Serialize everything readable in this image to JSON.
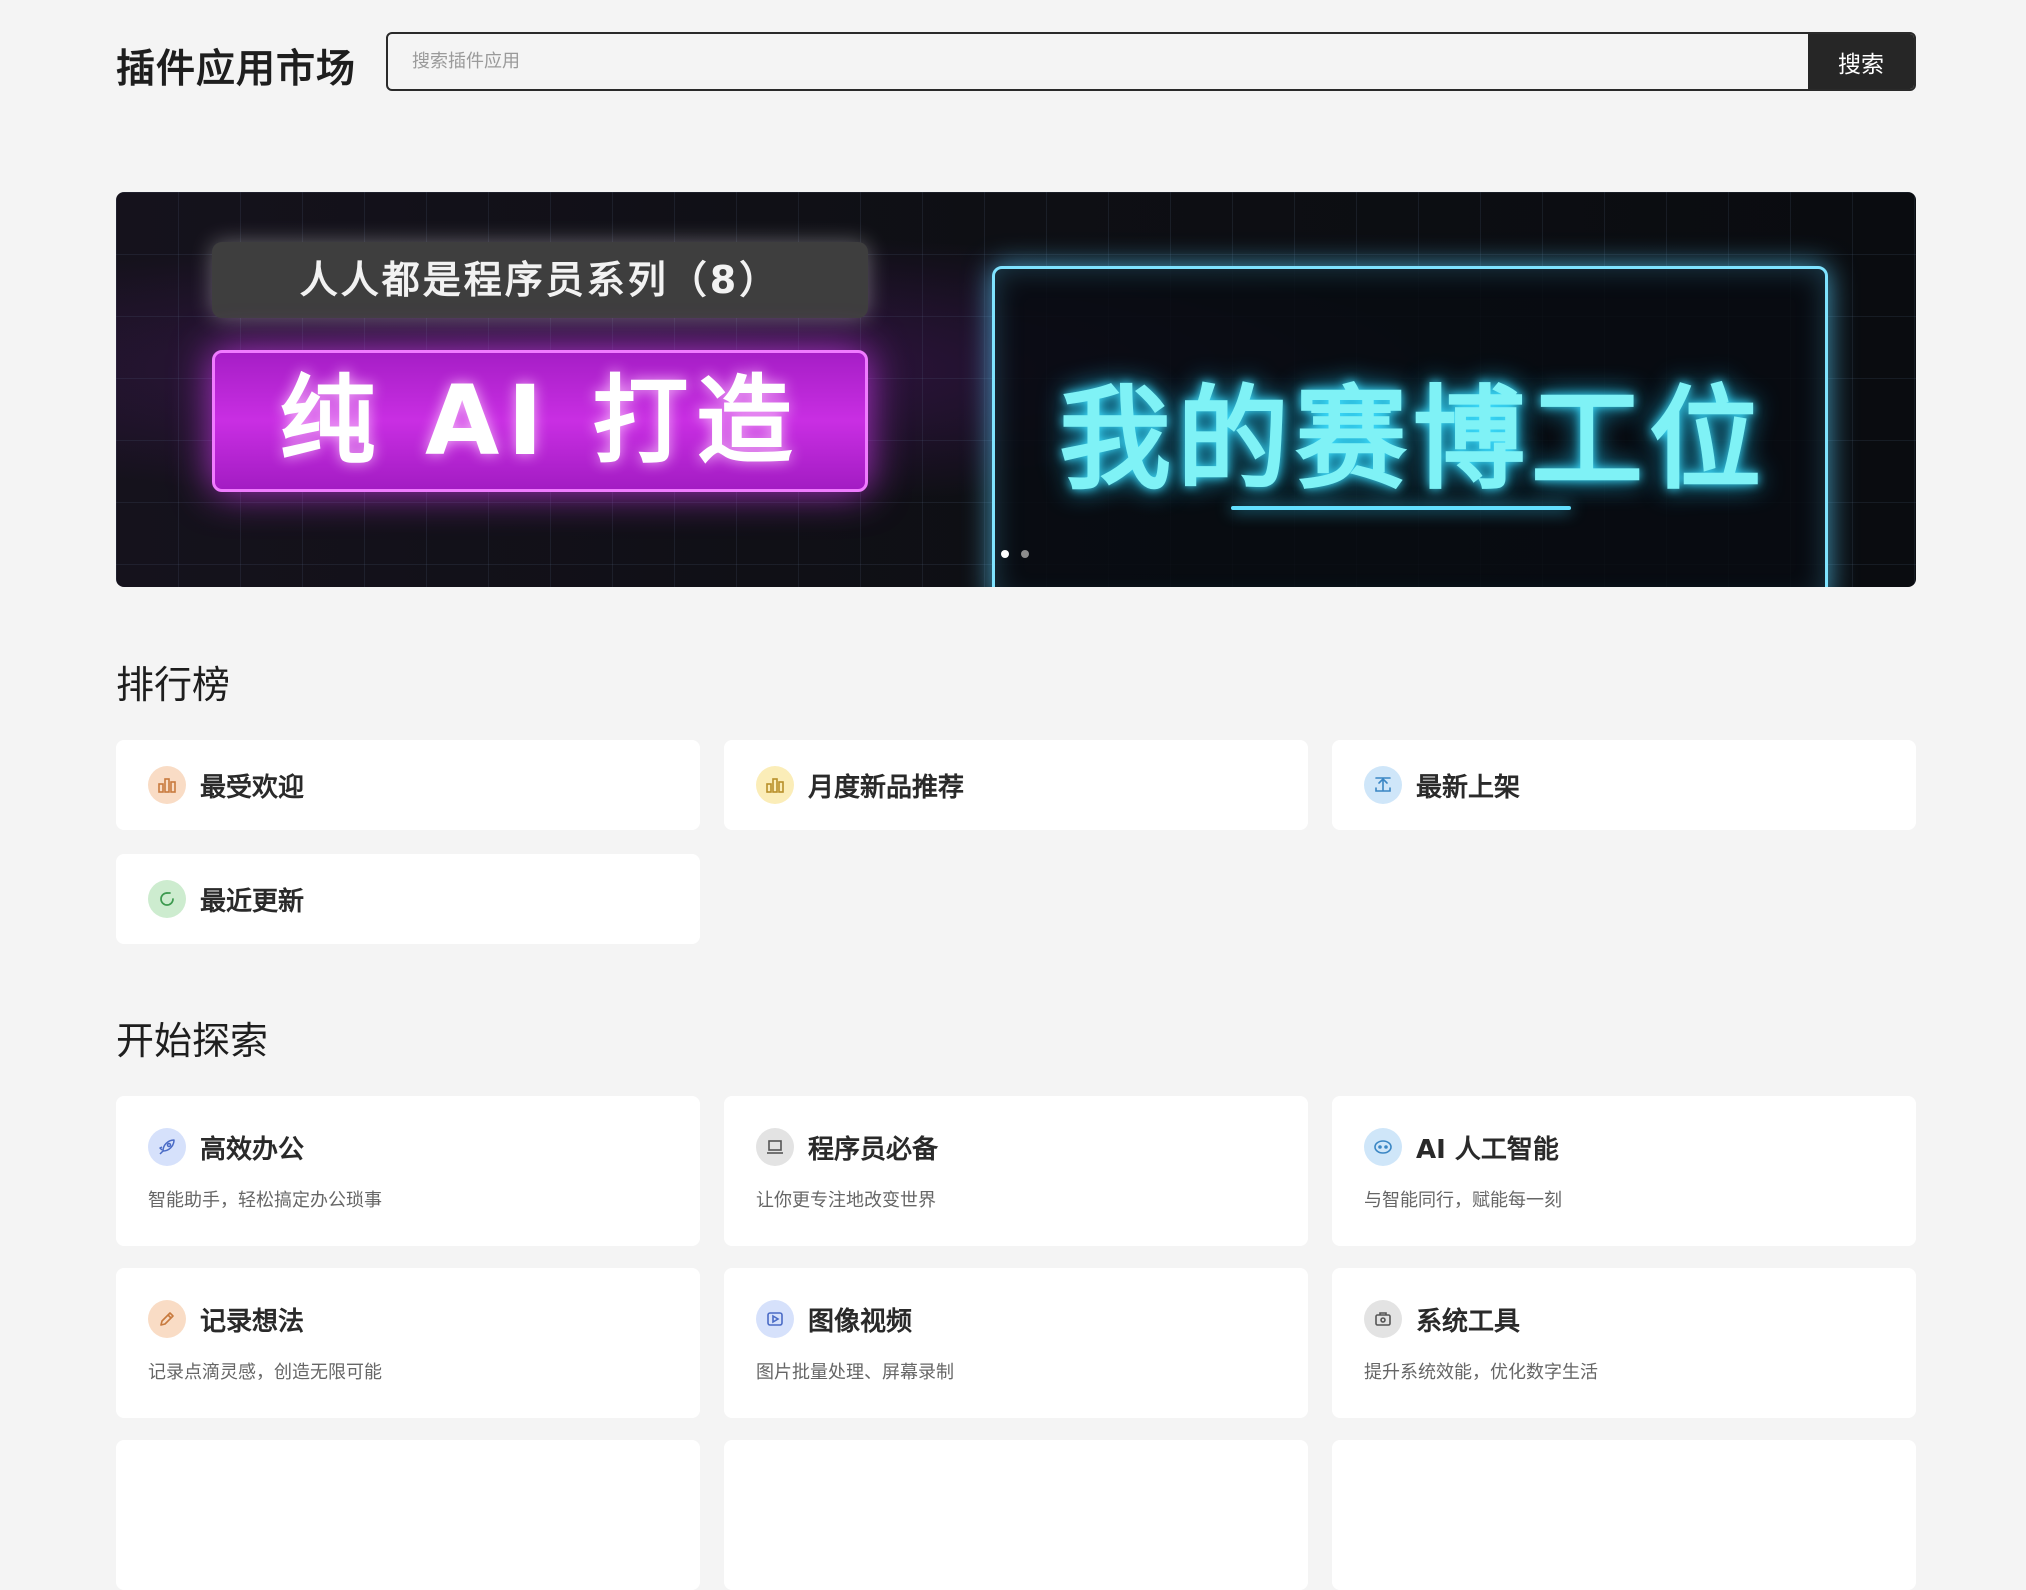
{
  "header": {
    "title": "插件应用市场",
    "search_placeholder": "搜索插件应用",
    "search_button": "搜索"
  },
  "banner": {
    "series": "人人都是程序员系列（8）",
    "headline": "纯 AI 打造",
    "subject": "我的赛博工位",
    "slide_count": 2,
    "active_slide": 1
  },
  "ranking": {
    "title": "排行榜",
    "items": [
      {
        "label": "最受欢迎",
        "icon": "bar-chart-icon",
        "color": "#f9dcc5"
      },
      {
        "label": "月度新品推荐",
        "icon": "bar-chart-icon",
        "color": "#fbedb8"
      },
      {
        "label": "最新上架",
        "icon": "upload-icon",
        "color": "#cfe6f9"
      },
      {
        "label": "最近更新",
        "icon": "refresh-icon",
        "color": "#cdeccf"
      }
    ]
  },
  "explore": {
    "title": "开始探索",
    "items": [
      {
        "label": "高效办公",
        "desc": "智能助手，轻松搞定办公琐事",
        "icon": "rocket-icon",
        "color": "#d6e1fb"
      },
      {
        "label": "程序员必备",
        "desc": "让你更专注地改变世界",
        "icon": "laptop-icon",
        "color": "#e3e3e3"
      },
      {
        "label": "AI 人工智能",
        "desc": "与智能同行，赋能每一刻",
        "icon": "robot-icon",
        "color": "#cfe6f9"
      },
      {
        "label": "记录想法",
        "desc": "记录点滴灵感，创造无限可能",
        "icon": "pencil-icon",
        "color": "#f9dcc5"
      },
      {
        "label": "图像视频",
        "desc": "图片批量处理、屏幕录制",
        "icon": "video-icon",
        "color": "#d6e1fb"
      },
      {
        "label": "系统工具",
        "desc": "提升系统效能，优化数字生活",
        "icon": "toolbox-icon",
        "color": "#e3e3e3"
      }
    ]
  }
}
